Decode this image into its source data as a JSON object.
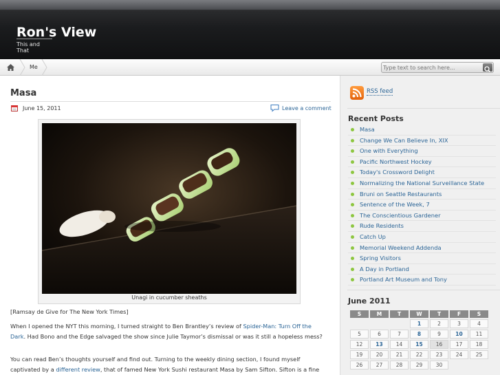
{
  "site": {
    "title": "Ron's View",
    "tagline": "This and That"
  },
  "nav": {
    "home_icon": "home-icon",
    "items": [
      {
        "label": "Me"
      }
    ]
  },
  "search": {
    "placeholder": "Type text to search here..."
  },
  "post": {
    "title": "Masa",
    "date": "June 15, 2011",
    "comment_link": "Leave a comment",
    "image_caption": "Unagi in cucumber sheaths",
    "credit": "[Ramsay de Give for The New York Times]",
    "p1": {
      "before": "When I opened the NYT this morning, I turned straight to Ben Brantley’s review of ",
      "link": "Spider-Man: Turn Off the Dark",
      "after": ". Had Bono and the Edge salvaged the show since Julie Taymor’s dismissal or was it still a hopeless mess?"
    },
    "p2": {
      "before": "You can read Ben’s thoughts yourself and find out. Turning to the weekly dining section, I found myself captivated by a ",
      "link": "different review",
      "after": ", that of famed New York Sushi restaurant Masa by Sam Sifton. Sifton is a fine"
    }
  },
  "sidebar": {
    "rss_label": "RSS feed",
    "recent_posts_title": "Recent Posts",
    "recent_posts": [
      "Masa",
      "Change We Can Believe In, XIX",
      "One with Everything",
      "Pacific Northwest Hockey",
      "Today's Crossword Delight",
      "Normalizing the National Surveillance State",
      "Bruni on Seattle Restaurants",
      "Sentence of the Week, 7",
      "The Conscientious Gardener",
      "Rude Residents",
      "Catch Up",
      "Memorial Weekend Addenda",
      "Spring Visitors",
      "A Day in Portland",
      "Portland Art Museum and Tony"
    ],
    "calendar": {
      "title": "June 2011",
      "days": [
        "S",
        "M",
        "T",
        "W",
        "T",
        "F",
        "S"
      ],
      "weeks": [
        [
          "",
          "",
          "",
          "1",
          "2",
          "3",
          "4"
        ],
        [
          "5",
          "6",
          "7",
          "8",
          "9",
          "10",
          "11"
        ],
        [
          "12",
          "13",
          "14",
          "15",
          "16",
          "17",
          "18"
        ],
        [
          "19",
          "20",
          "21",
          "22",
          "23",
          "24",
          "25"
        ],
        [
          "26",
          "27",
          "28",
          "29",
          "30",
          "",
          ""
        ]
      ],
      "linked_days": [
        "1",
        "8",
        "10",
        "13",
        "15"
      ],
      "today": "16"
    }
  },
  "colors": {
    "link": "#2a6496",
    "bullet": "#8dc63f",
    "rss": "#f08a24"
  }
}
